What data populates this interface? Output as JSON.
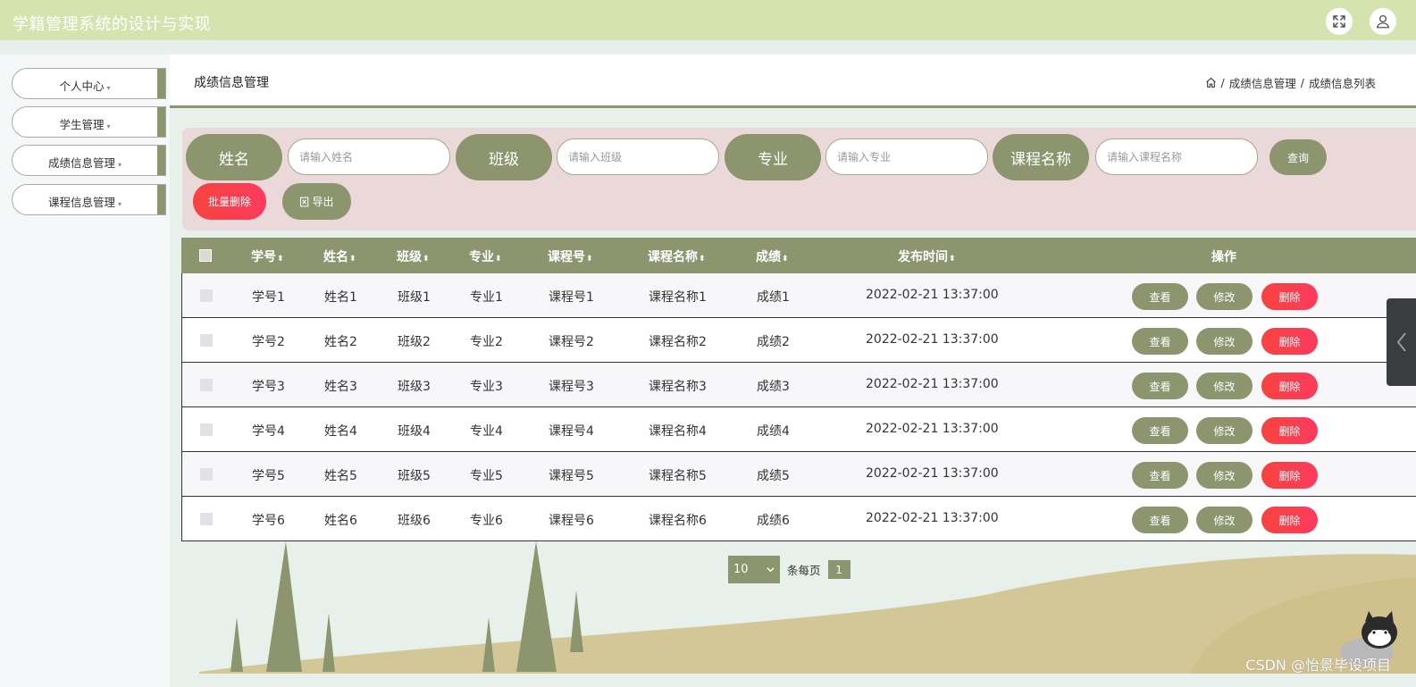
{
  "header": {
    "title": "学籍管理系统的设计与实现",
    "fullscreen_icon": "expand-icon",
    "user_icon": "user-icon",
    "background": "#d5e4af"
  },
  "sidebar": {
    "items": [
      {
        "label": "个人中心"
      },
      {
        "label": "学生管理"
      },
      {
        "label": "成绩信息管理"
      },
      {
        "label": "课程信息管理"
      }
    ],
    "caret": "▾"
  },
  "page": {
    "title": "成绩信息管理",
    "breadcrumb": {
      "sep": "/",
      "level1": "成绩信息管理",
      "level2": "成绩信息列表"
    }
  },
  "search": {
    "fields": [
      {
        "label": "姓名",
        "placeholder": "请输入姓名"
      },
      {
        "label": "班级",
        "placeholder": "请输入班级"
      },
      {
        "label": "专业",
        "placeholder": "请输入专业"
      },
      {
        "label": "课程名称",
        "placeholder": "请输入课程名称"
      }
    ],
    "query_label": "查询",
    "batch_delete_label": "批量删除",
    "export_label": "导出"
  },
  "table": {
    "columns": [
      "学号",
      "姓名",
      "班级",
      "专业",
      "课程号",
      "课程名称",
      "成绩",
      "发布时间",
      "操作"
    ],
    "sort_glyph": "⬍",
    "rows": [
      {
        "xuehao": "学号1",
        "xingming": "姓名1",
        "banji": "班级1",
        "zhuanye": "专业1",
        "kechenghao": "课程号1",
        "kechengmingcheng": "课程名称1",
        "chengji": "成绩1",
        "fabushijian": "2022-02-21 13:37:00"
      },
      {
        "xuehao": "学号2",
        "xingming": "姓名2",
        "banji": "班级2",
        "zhuanye": "专业2",
        "kechenghao": "课程号2",
        "kechengmingcheng": "课程名称2",
        "chengji": "成绩2",
        "fabushijian": "2022-02-21 13:37:00"
      },
      {
        "xuehao": "学号3",
        "xingming": "姓名3",
        "banji": "班级3",
        "zhuanye": "专业3",
        "kechenghao": "课程号3",
        "kechengmingcheng": "课程名称3",
        "chengji": "成绩3",
        "fabushijian": "2022-02-21 13:37:00"
      },
      {
        "xuehao": "学号4",
        "xingming": "姓名4",
        "banji": "班级4",
        "zhuanye": "专业4",
        "kechenghao": "课程号4",
        "kechengmingcheng": "课程名称4",
        "chengji": "成绩4",
        "fabushijian": "2022-02-21 13:37:00"
      },
      {
        "xuehao": "学号5",
        "xingming": "姓名5",
        "banji": "班级5",
        "zhuanye": "专业5",
        "kechenghao": "课程号5",
        "kechengmingcheng": "课程名称5",
        "chengji": "成绩5",
        "fabushijian": "2022-02-21 13:37:00"
      },
      {
        "xuehao": "学号6",
        "xingming": "姓名6",
        "banji": "班级6",
        "zhuanye": "专业6",
        "kechenghao": "课程号6",
        "kechengmingcheng": "课程名称6",
        "chengji": "成绩6",
        "fabushijian": "2022-02-21 13:37:00"
      }
    ],
    "actions": {
      "view": "查看",
      "edit": "修改",
      "delete": "删除"
    }
  },
  "pagination": {
    "page_size": "10",
    "per_page_label": "条每页",
    "current_page": "1"
  },
  "watermark": "CSDN @怡景毕设项目",
  "colors": {
    "olive": "#8c956e",
    "red": "#fc3a5d",
    "search_bg": "#ead9d8"
  }
}
